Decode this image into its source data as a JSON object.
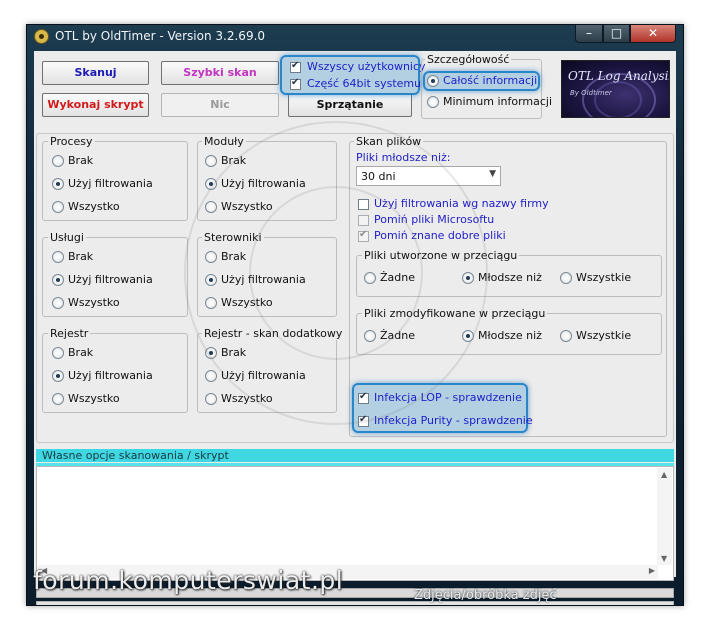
{
  "window": {
    "title": "OTL by OldTimer - Version 3.2.69.0",
    "controls": {
      "minimize": "–",
      "maximize": "□",
      "close": "✕"
    },
    "accent_color": "#2a86c8"
  },
  "toolbar": {
    "scan_label": "Skanuj",
    "quick_scan_label": "Szybki skan",
    "run_script_label": "Wykonaj skrypt",
    "nothing_label": "Nic",
    "cleanup_label": "Sprzątanie",
    "scan_label_color": "#1a1ab8",
    "quick_scan_color": "#c234c2",
    "run_script_color": "#d21a1a"
  },
  "users_options": {
    "all_users_label": "Wszyscy użytkownicy",
    "part64_label": "Część 64bit systemu",
    "all_users_checked": true,
    "part64_checked": true
  },
  "detail": {
    "label": "Szczegółowość",
    "full_label": "Całość informacji",
    "min_label": "Minimum informacji",
    "selected": "full"
  },
  "logo": {
    "title": "OTL Log Analysis",
    "subtitle": "By Oldtimer"
  },
  "groups": {
    "processes": {
      "label": "Procesy",
      "options": [
        "Brak",
        "Użyj filtrowania",
        "Wszystko"
      ],
      "selected": 1
    },
    "modules": {
      "label": "Moduły",
      "options": [
        "Brak",
        "Użyj filtrowania",
        "Wszystko"
      ],
      "selected": 1
    },
    "services": {
      "label": "Usługi",
      "options": [
        "Brak",
        "Użyj filtrowania",
        "Wszystko"
      ],
      "selected": 1
    },
    "drivers": {
      "label": "Sterowniki",
      "options": [
        "Brak",
        "Użyj filtrowania",
        "Wszystko"
      ],
      "selected": 1
    },
    "registry": {
      "label": "Rejestr",
      "options": [
        "Brak",
        "Użyj filtrowania",
        "Wszystko"
      ],
      "selected": 1
    },
    "registry_extra": {
      "label": "Rejestr - skan dodatkowy",
      "options": [
        "Brak",
        "Użyj filtrowania",
        "Wszystko"
      ],
      "selected": 0
    }
  },
  "file_scan": {
    "label": "Skan plików",
    "younger_label": "Pliki młodsze niż:",
    "younger_value": "30 dni",
    "use_filter_label": "Użyj filtrowania wg nazwy firmy",
    "skip_ms_label": "Pomiń pliki Microsoftu",
    "skip_good_label": "Pomiń znane dobre pliki",
    "use_filter_checked": false,
    "skip_ms_checked": false,
    "skip_good_checked": true,
    "created": {
      "label": "Pliki utworzone w przeciągu",
      "options": [
        "Żadne",
        "Młodsze niż",
        "Wszystkie"
      ],
      "selected": 1
    },
    "modified": {
      "label": "Pliki zmodyfikowane w przeciągu",
      "options": [
        "Żadne",
        "Młodsze niż",
        "Wszystkie"
      ],
      "selected": 1
    },
    "lop_label": "Infekcja LOP - sprawdzenie",
    "purity_label": "Infekcja Purity - sprawdzenie",
    "lop_checked": true,
    "purity_checked": true
  },
  "custom": {
    "label": "Własne opcje skanowania / skrypt",
    "header_color": "#3fd7e2",
    "value": ""
  },
  "watermark": {
    "text": "forum.komputerswiat.pl",
    "credit": "Zdjęcia/obróbka zdjęć"
  }
}
